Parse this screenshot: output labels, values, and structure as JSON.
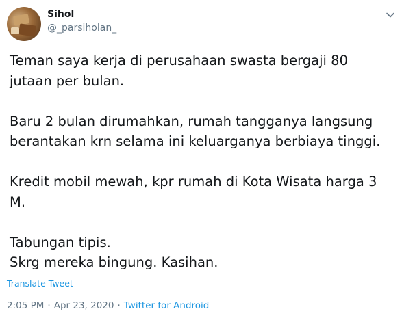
{
  "tweet": {
    "display_name": "Sihol",
    "handle": "@_parsiholan_",
    "paragraphs": [
      "Teman saya kerja di perusahaan swasta bergaji 80\njutaan per bulan.",
      "Baru 2 bulan dirumahkan, rumah tangganya langsung\nberantakan krn selama ini keluarganya berbiaya tinggi.",
      "Kredit mobil mewah, kpr rumah di Kota Wisata harga 3\nM.",
      "Tabungan tipis.\nSkrg mereka bingung. Kasihan."
    ],
    "translate_label": "Translate Tweet",
    "time": "2:05 PM",
    "date": "Apr 23, 2020",
    "separator": "·",
    "source": "Twitter for Android"
  },
  "icons": {
    "menu": "chevron-down-icon",
    "avatar": "avatar"
  },
  "colors": {
    "text": "#14171a",
    "secondary": "#657786",
    "link": "#1b95e0"
  }
}
